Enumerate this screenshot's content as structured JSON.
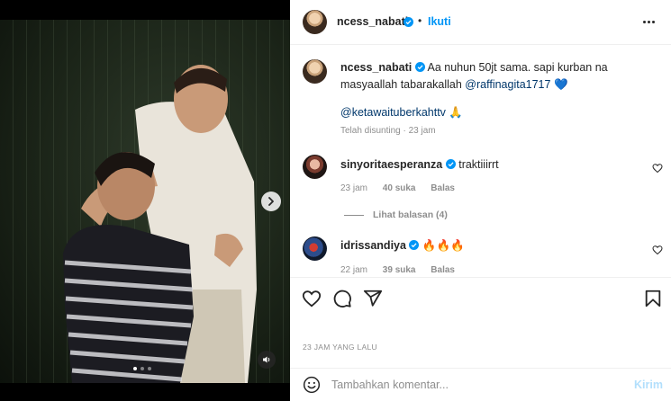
{
  "post": {
    "username": "ncess_nabati",
    "follow_label": "Ikuti",
    "more_icon": "more-horizontal-icon"
  },
  "caption": {
    "username": "ncess_nabati",
    "text": "Aa nuhun 50jt sama. sapi kurban na masyaallah tabarakallah",
    "mention1": "@raffinagita1717",
    "emoji_heart": "💙",
    "mention2": "@ketawaituberkahttv",
    "emoji_pray": "🙏",
    "edited": "Telah disunting · 23 jam"
  },
  "comments": [
    {
      "username": "sinyoritaesperanza",
      "text": "traktiiirrt",
      "time": "23 jam",
      "likes": "40 suka",
      "reply": "Balas",
      "view_replies": "Lihat balasan (4)"
    },
    {
      "username": "idrissandiya",
      "text": "🔥🔥🔥",
      "time": "22 jam",
      "likes": "39 suka",
      "reply": "Balas"
    }
  ],
  "timestamp": "23 JAM YANG LALU",
  "composer": {
    "placeholder": "Tambahkan komentar...",
    "send_label": "Kirim"
  },
  "carousel": {
    "slide_count": 3,
    "active_index": 0
  },
  "colors": {
    "accent": "#0095f6",
    "verified": "#0095f6",
    "send_disabled": "#b2dffc",
    "mention": "#00376b"
  }
}
